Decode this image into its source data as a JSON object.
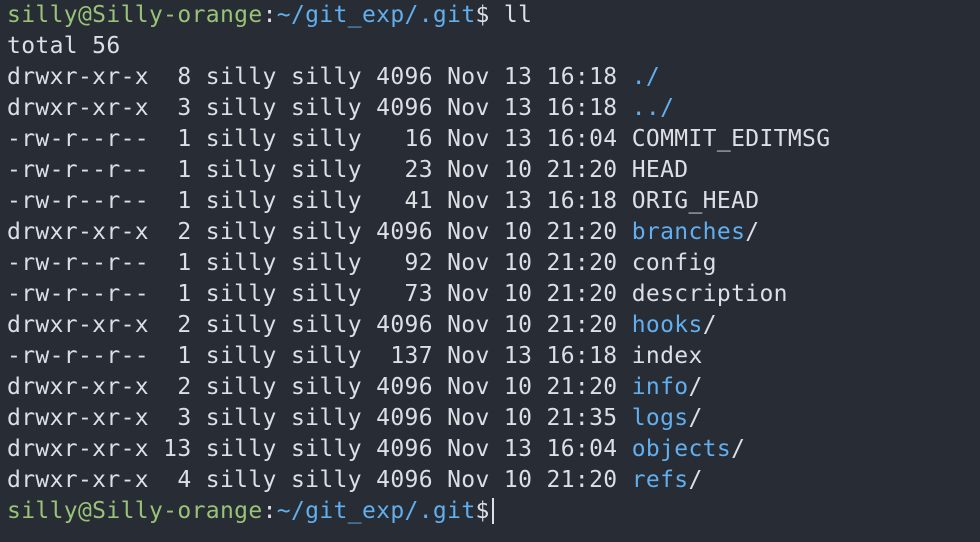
{
  "terminal": {
    "colors": {
      "background": "#282c34",
      "text": "#dcdfe4",
      "prompt_user": "#98c379",
      "path": "#61afef",
      "directory": "#61afef"
    },
    "prompt": {
      "user_host": "silly@Silly-orange",
      "separator": ":",
      "path": "~/git_exp/.git",
      "symbol": "$"
    },
    "command": " ll",
    "total": "total 56",
    "entries": [
      {
        "meta": "drwxr-xr-x  8 silly silly 4096 Nov 13 16:18 ",
        "name": "./",
        "suffix": "",
        "is_dir": true
      },
      {
        "meta": "drwxr-xr-x  3 silly silly 4096 Nov 13 16:18 ",
        "name": "../",
        "suffix": "",
        "is_dir": true
      },
      {
        "meta": "-rw-r--r--  1 silly silly   16 Nov 13 16:04 ",
        "name": "COMMIT_EDITMSG",
        "suffix": "",
        "is_dir": false
      },
      {
        "meta": "-rw-r--r--  1 silly silly   23 Nov 10 21:20 ",
        "name": "HEAD",
        "suffix": "",
        "is_dir": false
      },
      {
        "meta": "-rw-r--r--  1 silly silly   41 Nov 13 16:18 ",
        "name": "ORIG_HEAD",
        "suffix": "",
        "is_dir": false
      },
      {
        "meta": "drwxr-xr-x  2 silly silly 4096 Nov 10 21:20 ",
        "name": "branches",
        "suffix": "/",
        "is_dir": true
      },
      {
        "meta": "-rw-r--r--  1 silly silly   92 Nov 10 21:20 ",
        "name": "config",
        "suffix": "",
        "is_dir": false
      },
      {
        "meta": "-rw-r--r--  1 silly silly   73 Nov 10 21:20 ",
        "name": "description",
        "suffix": "",
        "is_dir": false
      },
      {
        "meta": "drwxr-xr-x  2 silly silly 4096 Nov 10 21:20 ",
        "name": "hooks",
        "suffix": "/",
        "is_dir": true
      },
      {
        "meta": "-rw-r--r--  1 silly silly  137 Nov 13 16:18 ",
        "name": "index",
        "suffix": "",
        "is_dir": false
      },
      {
        "meta": "drwxr-xr-x  2 silly silly 4096 Nov 10 21:20 ",
        "name": "info",
        "suffix": "/",
        "is_dir": true
      },
      {
        "meta": "drwxr-xr-x  3 silly silly 4096 Nov 10 21:35 ",
        "name": "logs",
        "suffix": "/",
        "is_dir": true
      },
      {
        "meta": "drwxr-xr-x 13 silly silly 4096 Nov 13 16:04 ",
        "name": "objects",
        "suffix": "/",
        "is_dir": true
      },
      {
        "meta": "drwxr-xr-x  4 silly silly 4096 Nov 10 21:20 ",
        "name": "refs",
        "suffix": "/",
        "is_dir": true
      }
    ],
    "next_input": ""
  }
}
